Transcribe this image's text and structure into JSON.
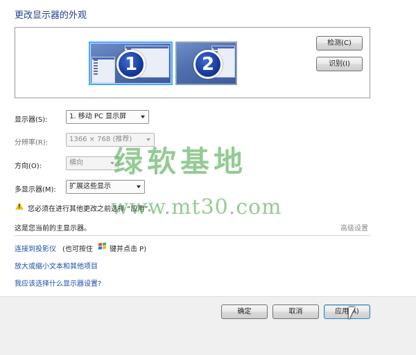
{
  "page": {
    "title": "更改显示器的外观"
  },
  "preview": {
    "monitor1_number": "1",
    "monitor2_number": "2",
    "detect_button": "检测(C)",
    "identify_button": "识别(I)"
  },
  "settings": {
    "display_label": "显示器(S):",
    "display_value": "1. 移动 PC 显示屏",
    "resolution_label": "分辨率(R):",
    "resolution_value": "1366 × 768 (推荐)",
    "orientation_label": "方向(O):",
    "orientation_value": "横向",
    "multi_label": "多显示器(M):",
    "multi_value": "扩展这些显示"
  },
  "status": {
    "warning_text": "您必须在进行其他更改之前选择 “应用”。",
    "primary_text": "这是您当前的主显示器。",
    "advanced_link": "高级设置"
  },
  "links": {
    "projector_link": "连接到投影仪",
    "projector_hint_before": "(也可按住",
    "projector_hint_after": "键并点击 P)",
    "text_size_link": "放大或缩小文本和其他项目",
    "which_settings_link": "我应该选择什么显示器设置?"
  },
  "footer": {
    "ok": "确定",
    "cancel": "取消",
    "apply": "应用(A)"
  },
  "watermark": {
    "line1": "绿软基地",
    "line2": "www.mt30.com"
  },
  "colors": {
    "title": "#1f3f8c",
    "link": "#1a4ea8",
    "monitor_selected_border": "#46a6ff"
  }
}
